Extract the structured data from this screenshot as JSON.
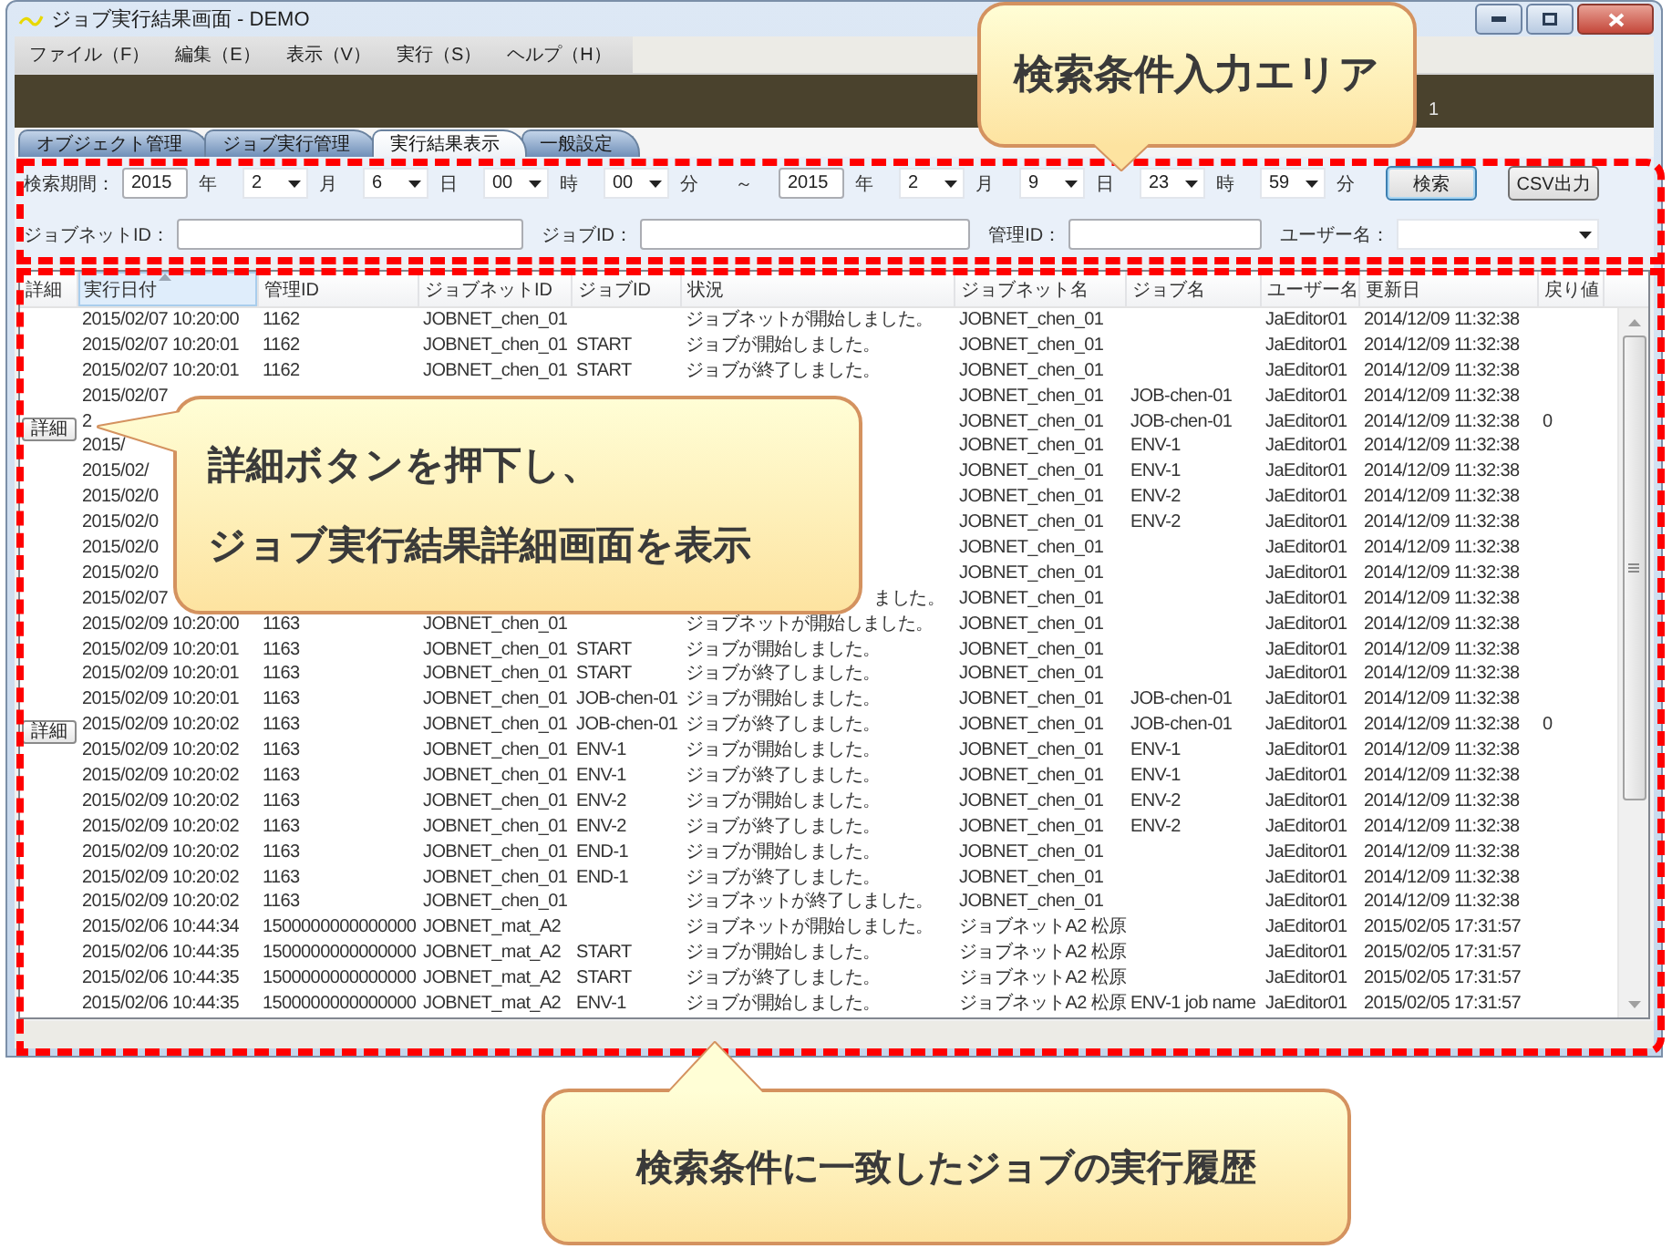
{
  "window": {
    "title": "ジョブ実行結果画面 - DEMO"
  },
  "menu": [
    "ファイル（F）",
    "編集（E）",
    "表示（V）",
    "実行（S）",
    "ヘルプ（H）"
  ],
  "banner": {
    "text": "1"
  },
  "tabs": [
    {
      "label": "オブジェクト管理",
      "selected": false
    },
    {
      "label": "ジョブ実行管理",
      "selected": false
    },
    {
      "label": "実行結果表示",
      "selected": true
    },
    {
      "label": "一般設定",
      "selected": false
    }
  ],
  "search": {
    "row_1": [
      {
        "kind": "label",
        "text": "検索期間："
      },
      {
        "kind": "input",
        "value": "2015"
      },
      {
        "kind": "unit",
        "text": "年"
      },
      {
        "kind": "select",
        "value": "2"
      },
      {
        "kind": "unit",
        "text": "月"
      },
      {
        "kind": "select",
        "value": "6"
      },
      {
        "kind": "unit",
        "text": "日"
      },
      {
        "kind": "select",
        "value": "00"
      },
      {
        "kind": "unit",
        "text": "時"
      },
      {
        "kind": "select",
        "value": "00"
      },
      {
        "kind": "unit",
        "text": "分"
      },
      {
        "kind": "unit",
        "text": "～"
      },
      {
        "kind": "input",
        "value": "2015"
      },
      {
        "kind": "unit",
        "text": "年"
      },
      {
        "kind": "select",
        "value": "2"
      },
      {
        "kind": "unit",
        "text": "月"
      },
      {
        "kind": "select",
        "value": "9"
      },
      {
        "kind": "unit",
        "text": "日"
      },
      {
        "kind": "select",
        "value": "23"
      },
      {
        "kind": "unit",
        "text": "時"
      },
      {
        "kind": "select",
        "value": "59"
      },
      {
        "kind": "unit",
        "text": "分"
      },
      {
        "kind": "button",
        "label": "検索",
        "default": true
      },
      {
        "kind": "button",
        "label": "CSV出力",
        "default": false
      }
    ],
    "row_2": [
      {
        "kind": "label",
        "text": "ジョブネットID："
      },
      {
        "kind": "input"
      },
      {
        "kind": "label",
        "text": "ジョブID："
      },
      {
        "kind": "input"
      },
      {
        "kind": "label",
        "text": "管理ID："
      },
      {
        "kind": "input"
      },
      {
        "kind": "label",
        "text": "ユーザー名："
      },
      {
        "kind": "select"
      }
    ]
  },
  "table": {
    "columns": [
      {
        "label": "詳細",
        "sorted": false
      },
      {
        "label": "実行日付",
        "sorted": true
      },
      {
        "label": "管理ID",
        "sorted": false
      },
      {
        "label": "ジョブネットID",
        "sorted": false
      },
      {
        "label": "ジョブID",
        "sorted": false
      },
      {
        "label": "状況",
        "sorted": false
      },
      {
        "label": "ジョブネット名",
        "sorted": false
      },
      {
        "label": "ジョブ名",
        "sorted": false
      },
      {
        "label": "ユーザー名",
        "sorted": false
      },
      {
        "label": "更新日",
        "sorted": false
      },
      {
        "label": "戻り値",
        "sorted": false
      }
    ],
    "rows": [
      {
        "cells": [
          "",
          "2015/02/07 10:20:00",
          "1162",
          "JOBNET_chen_01",
          "",
          "ジョブネットが開始しました。",
          "JOBNET_chen_01",
          "",
          "JaEditor01",
          "2014/12/09 11:32:38",
          ""
        ]
      },
      {
        "cells": [
          "",
          "2015/02/07 10:20:01",
          "1162",
          "JOBNET_chen_01",
          "START",
          "ジョブが開始しました。",
          "JOBNET_chen_01",
          "",
          "JaEditor01",
          "2014/12/09 11:32:38",
          ""
        ]
      },
      {
        "cells": [
          "",
          "2015/02/07 10:20:01",
          "1162",
          "JOBNET_chen_01",
          "START",
          "ジョブが終了しました。",
          "JOBNET_chen_01",
          "",
          "JaEditor01",
          "2014/12/09 11:32:38",
          ""
        ]
      },
      {
        "cells": [
          "",
          "2015/02/07",
          "",
          "",
          "",
          "",
          "JOBNET_chen_01",
          "JOB-chen-01",
          "JaEditor01",
          "2014/12/09 11:32:38",
          ""
        ]
      },
      {
        "cells": [
          "詳細",
          "2",
          "",
          "",
          "",
          "",
          "JOBNET_chen_01",
          "JOB-chen-01",
          "JaEditor01",
          "2014/12/09 11:32:38",
          "0"
        ]
      },
      {
        "cells": [
          "",
          "2015/",
          "",
          "",
          "",
          "",
          "JOBNET_chen_01",
          "ENV-1",
          "JaEditor01",
          "2014/12/09 11:32:38",
          ""
        ]
      },
      {
        "cells": [
          "",
          "2015/02/",
          "",
          "",
          "",
          "",
          "JOBNET_chen_01",
          "ENV-1",
          "JaEditor01",
          "2014/12/09 11:32:38",
          ""
        ]
      },
      {
        "cells": [
          "",
          "2015/02/0",
          "",
          "",
          "",
          "",
          "JOBNET_chen_01",
          "ENV-2",
          "JaEditor01",
          "2014/12/09 11:32:38",
          ""
        ]
      },
      {
        "cells": [
          "",
          "2015/02/0",
          "",
          "",
          "",
          "",
          "JOBNET_chen_01",
          "ENV-2",
          "JaEditor01",
          "2014/12/09 11:32:38",
          ""
        ]
      },
      {
        "cells": [
          "",
          "2015/02/0",
          "",
          "",
          "",
          "",
          "JOBNET_chen_01",
          "",
          "JaEditor01",
          "2014/12/09 11:32:38",
          ""
        ]
      },
      {
        "cells": [
          "",
          "2015/02/0",
          "",
          "",
          "",
          "",
          "JOBNET_chen_01",
          "",
          "JaEditor01",
          "2014/12/09 11:32:38",
          ""
        ]
      },
      {
        "status_cut_left": true,
        "cells": [
          "",
          "2015/02/07",
          "",
          "",
          "",
          "ました。",
          "JOBNET_chen_01",
          "",
          "JaEditor01",
          "2014/12/09 11:32:38",
          ""
        ]
      },
      {
        "cells": [
          "",
          "2015/02/09 10:20:00",
          "1163",
          "JOBNET_chen_01",
          "",
          "ジョブネットが開始しました。",
          "JOBNET_chen_01",
          "",
          "JaEditor01",
          "2014/12/09 11:32:38",
          ""
        ]
      },
      {
        "cells": [
          "",
          "2015/02/09 10:20:01",
          "1163",
          "JOBNET_chen_01",
          "START",
          "ジョブが開始しました。",
          "JOBNET_chen_01",
          "",
          "JaEditor01",
          "2014/12/09 11:32:38",
          ""
        ]
      },
      {
        "cells": [
          "",
          "2015/02/09 10:20:01",
          "1163",
          "JOBNET_chen_01",
          "START",
          "ジョブが終了しました。",
          "JOBNET_chen_01",
          "",
          "JaEditor01",
          "2014/12/09 11:32:38",
          ""
        ]
      },
      {
        "cells": [
          "",
          "2015/02/09 10:20:01",
          "1163",
          "JOBNET_chen_01",
          "JOB-chen-01",
          "ジョブが開始しました。",
          "JOBNET_chen_01",
          "JOB-chen-01",
          "JaEditor01",
          "2014/12/09 11:32:38",
          ""
        ]
      },
      {
        "cells": [
          "詳細",
          "2015/02/09 10:20:02",
          "1163",
          "JOBNET_chen_01",
          "JOB-chen-01",
          "ジョブが終了しました。",
          "JOBNET_chen_01",
          "JOB-chen-01",
          "JaEditor01",
          "2014/12/09 11:32:38",
          "0"
        ]
      },
      {
        "cells": [
          "",
          "2015/02/09 10:20:02",
          "1163",
          "JOBNET_chen_01",
          "ENV-1",
          "ジョブが開始しました。",
          "JOBNET_chen_01",
          "ENV-1",
          "JaEditor01",
          "2014/12/09 11:32:38",
          ""
        ]
      },
      {
        "cells": [
          "",
          "2015/02/09 10:20:02",
          "1163",
          "JOBNET_chen_01",
          "ENV-1",
          "ジョブが終了しました。",
          "JOBNET_chen_01",
          "ENV-1",
          "JaEditor01",
          "2014/12/09 11:32:38",
          ""
        ]
      },
      {
        "cells": [
          "",
          "2015/02/09 10:20:02",
          "1163",
          "JOBNET_chen_01",
          "ENV-2",
          "ジョブが開始しました。",
          "JOBNET_chen_01",
          "ENV-2",
          "JaEditor01",
          "2014/12/09 11:32:38",
          ""
        ]
      },
      {
        "cells": [
          "",
          "2015/02/09 10:20:02",
          "1163",
          "JOBNET_chen_01",
          "ENV-2",
          "ジョブが終了しました。",
          "JOBNET_chen_01",
          "ENV-2",
          "JaEditor01",
          "2014/12/09 11:32:38",
          ""
        ]
      },
      {
        "cells": [
          "",
          "2015/02/09 10:20:02",
          "1163",
          "JOBNET_chen_01",
          "END-1",
          "ジョブが開始しました。",
          "JOBNET_chen_01",
          "",
          "JaEditor01",
          "2014/12/09 11:32:38",
          ""
        ]
      },
      {
        "cells": [
          "",
          "2015/02/09 10:20:02",
          "1163",
          "JOBNET_chen_01",
          "END-1",
          "ジョブが終了しました。",
          "JOBNET_chen_01",
          "",
          "JaEditor01",
          "2014/12/09 11:32:38",
          ""
        ]
      },
      {
        "cells": [
          "",
          "2015/02/09 10:20:02",
          "1163",
          "JOBNET_chen_01",
          "",
          "ジョブネットが終了しました。",
          "JOBNET_chen_01",
          "",
          "JaEditor01",
          "2014/12/09 11:32:38",
          ""
        ]
      },
      {
        "cells": [
          "",
          "2015/02/06 10:44:34",
          "1500000000000000",
          "JOBNET_mat_A2",
          "",
          "ジョブネットが開始しました。",
          "ジョブネットA2 松原",
          "",
          "JaEditor01",
          "2015/02/05 17:31:57",
          ""
        ]
      },
      {
        "cells": [
          "",
          "2015/02/06 10:44:35",
          "1500000000000000",
          "JOBNET_mat_A2",
          "START",
          "ジョブが開始しました。",
          "ジョブネットA2 松原",
          "",
          "JaEditor01",
          "2015/02/05 17:31:57",
          ""
        ]
      },
      {
        "cells": [
          "",
          "2015/02/06 10:44:35",
          "1500000000000000",
          "JOBNET_mat_A2",
          "START",
          "ジョブが終了しました。",
          "ジョブネットA2 松原",
          "",
          "JaEditor01",
          "2015/02/05 17:31:57",
          ""
        ]
      },
      {
        "cells": [
          "",
          "2015/02/06 10:44:35",
          "1500000000000000",
          "JOBNET_mat_A2",
          "ENV-1",
          "ジョブが開始しました。",
          "ジョブネットA2 松原",
          "ENV-1 job name",
          "JaEditor01",
          "2015/02/05 17:31:57",
          ""
        ]
      }
    ]
  },
  "callouts": [
    {
      "lines": [
        "検索条件入力エリア"
      ]
    },
    {
      "lines": [
        "詳細ボタンを押下し、",
        "ジョブ実行結果詳細画面を表示"
      ]
    },
    {
      "lines": [
        "検索条件に一致したジョブの実行履歴"
      ]
    }
  ]
}
